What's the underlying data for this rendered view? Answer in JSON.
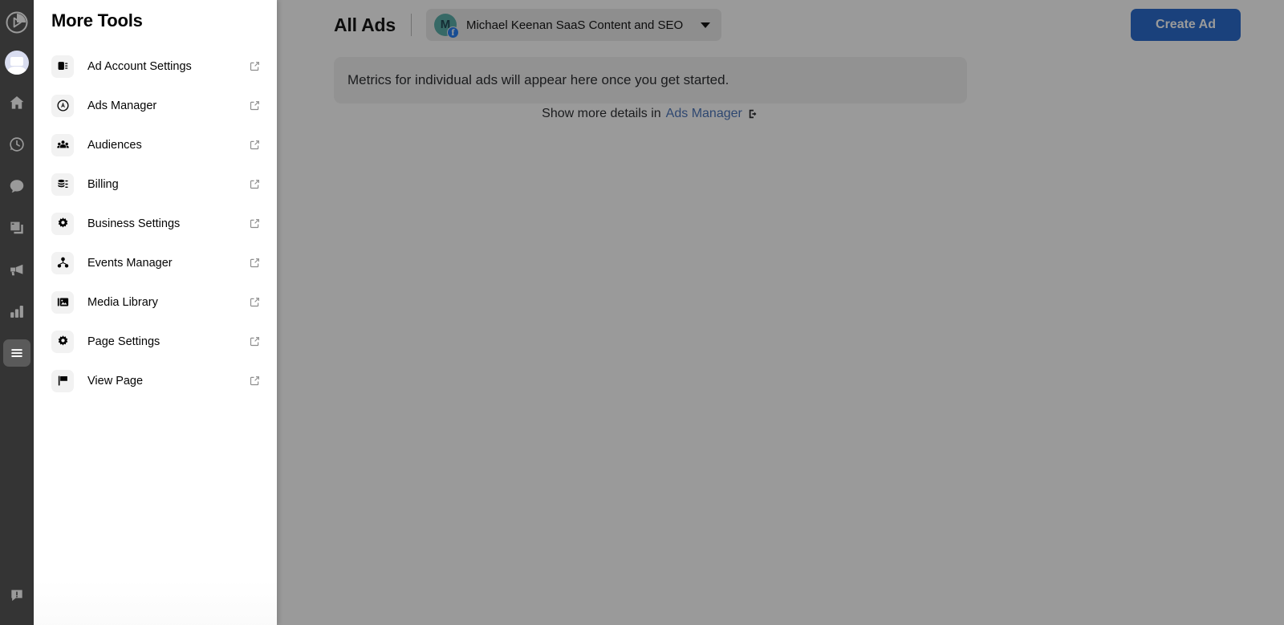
{
  "window": {
    "title": "All Ads"
  },
  "rail": {
    "items": [
      {
        "name": "brand-logo",
        "icon": "play-circle-icon",
        "active": false
      },
      {
        "name": "profile-avatar",
        "icon": "avatar-icon",
        "active": false
      },
      {
        "name": "home",
        "icon": "home-icon",
        "active": false
      },
      {
        "name": "history",
        "icon": "clock-history-icon",
        "active": false
      },
      {
        "name": "messages",
        "icon": "chat-bubble-icon",
        "active": false
      },
      {
        "name": "pages",
        "icon": "windows-icon",
        "active": false
      },
      {
        "name": "ads",
        "icon": "megaphone-icon",
        "active": false
      },
      {
        "name": "insights",
        "icon": "bar-chart-icon",
        "active": false
      },
      {
        "name": "more-tools",
        "icon": "hamburger-menu-icon",
        "active": true
      }
    ],
    "bottom": {
      "name": "feedback",
      "icon": "alert-bubble-icon"
    }
  },
  "panel": {
    "title": "More Tools",
    "items": [
      {
        "label": "Ad Account Settings",
        "icon": "ad-account-icon",
        "external": true
      },
      {
        "label": "Ads Manager",
        "icon": "ads-manager-icon",
        "external": true
      },
      {
        "label": "Audiences",
        "icon": "audiences-people-icon",
        "external": true
      },
      {
        "label": "Billing",
        "icon": "billing-coins-icon",
        "external": true
      },
      {
        "label": "Business Settings",
        "icon": "gear-icon",
        "external": true
      },
      {
        "label": "Events Manager",
        "icon": "events-manager-icon",
        "external": true
      },
      {
        "label": "Media Library",
        "icon": "media-library-image-icon",
        "external": true
      },
      {
        "label": "Page Settings",
        "icon": "gear-icon",
        "external": true
      },
      {
        "label": "View Page",
        "icon": "flag-icon",
        "external": true
      }
    ]
  },
  "header": {
    "title": "All Ads",
    "page_picker": {
      "avatar_initial": "M",
      "platform_badge": "facebook-icon",
      "label": "Michael Keenan SaaS Content and SEO",
      "caret": "chevron-down-icon"
    },
    "create_ad_label": "Create Ad"
  },
  "main": {
    "empty_state_message": "Metrics for individual ads will appear here once you get started.",
    "details_prefix": "Show more details in",
    "details_link": "Ads Manager",
    "details_link_icon": "external-exit-icon"
  },
  "colors": {
    "accent_blue": "#1877f2",
    "create_ad_blue": "#1b61c9",
    "link_blue": "#3f6bb5",
    "rail_bg": "#343434",
    "panel_bg": "#ffffff",
    "icon_tile_bg": "#f2f2f2",
    "scrim": "rgba(24,24,24,0.44)"
  }
}
